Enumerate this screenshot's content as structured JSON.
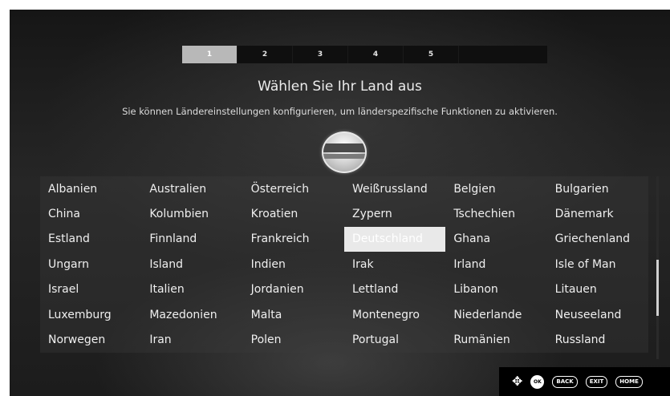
{
  "steps": [
    "1",
    "2",
    "3",
    "4",
    "5"
  ],
  "active_step": "1",
  "title": "Wählen Sie Ihr Land aus",
  "subtitle": "Sie können Ländereinstellungen konfigurieren, um länderspezifische Funktionen zu aktivieren.",
  "countries": [
    [
      "Albanien",
      "Australien",
      "Österreich",
      "Weißrussland",
      "Belgien",
      "Bulgarien"
    ],
    [
      "China",
      "Kolumbien",
      "Kroatien",
      "Zypern",
      "Tschechien",
      "Dänemark"
    ],
    [
      "Estland",
      "Finnland",
      "Frankreich",
      "Deutschland",
      "Ghana",
      "Griechenland"
    ],
    [
      "Ungarn",
      "Island",
      "Indien",
      "Irak",
      "Irland",
      "Isle of Man"
    ],
    [
      "Israel",
      "Italien",
      "Jordanien",
      "Lettland",
      "Libanon",
      "Litauen"
    ],
    [
      "Luxemburg",
      "Mazedonien",
      "Malta",
      "Montenegro",
      "Niederlande",
      "Neuseeland"
    ],
    [
      "Norwegen",
      "Iran",
      "Polen",
      "Portugal",
      "Rumänien",
      "Russland"
    ]
  ],
  "selected_country": "Deutschland",
  "scroll_position": 0.66,
  "footer": {
    "nav_icon": "dpad-icon",
    "ok_label": "OK",
    "back_label": "BACK",
    "exit_label": "EXIT",
    "home_label": "HOME"
  }
}
